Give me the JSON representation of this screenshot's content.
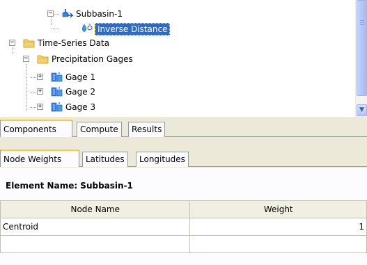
{
  "tree": {
    "nodes": [
      {
        "label": "Subbasin-1",
        "icon": "subbasin-icon",
        "expanded": true
      },
      {
        "label": "Inverse Distance",
        "icon": "inverse-distance-icon",
        "selected": true
      },
      {
        "label": "Time-Series Data",
        "icon": "folder-icon",
        "expanded": true
      },
      {
        "label": "Precipitation Gages",
        "icon": "folder-icon",
        "expanded": true
      },
      {
        "label": "Gage 1",
        "icon": "gage-icon",
        "expanded": false
      },
      {
        "label": "Gage 2",
        "icon": "gage-icon",
        "expanded": false
      },
      {
        "label": "Gage 3",
        "icon": "gage-icon",
        "expanded": false
      }
    ]
  },
  "tabs_outer": [
    {
      "label": "Components",
      "active": true
    },
    {
      "label": "Compute",
      "active": false
    },
    {
      "label": "Results",
      "active": false
    }
  ],
  "tabs_inner": [
    {
      "label": "Node Weights",
      "active": true
    },
    {
      "label": "Latitudes",
      "active": false
    },
    {
      "label": "Longitudes",
      "active": false
    }
  ],
  "element_name": "Element Name: Subbasin-1",
  "table": {
    "columns": [
      "Node Name",
      "Weight"
    ],
    "rows": [
      [
        "Centroid",
        "1"
      ],
      [
        "",
        ""
      ]
    ]
  },
  "icons": {
    "expanded": "minus-box-icon",
    "collapsed": "plus-box-icon",
    "scroll_down": "chevron-down-icon"
  },
  "colors": {
    "selection": "#316ac5",
    "active_tab_accent": "#ffc83c",
    "folder": "#f5d36b"
  }
}
